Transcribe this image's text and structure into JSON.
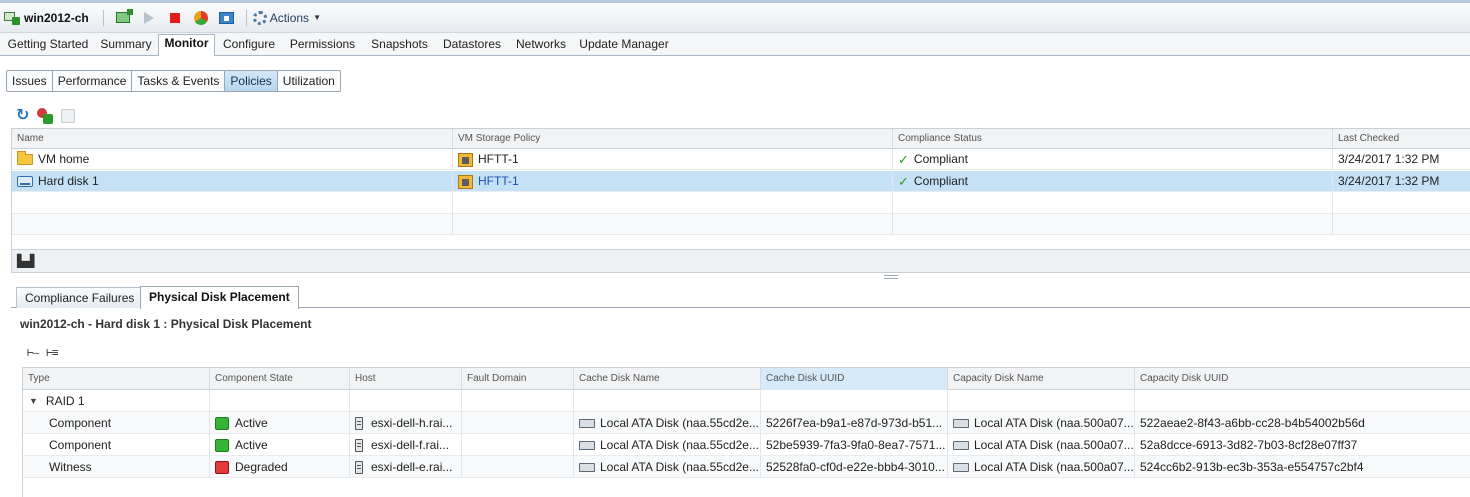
{
  "toolbar": {
    "vm_name": "win2012-ch",
    "actions_label": "Actions",
    "icons": [
      "vm-icon",
      "open-console-icon",
      "power-on-icon",
      "power-off-icon",
      "restart-guest-icon",
      "migrate-icon",
      "gear-icon"
    ]
  },
  "main_tabs": [
    "Getting Started",
    "Summary",
    "Monitor",
    "Configure",
    "Permissions",
    "Snapshots",
    "Datastores",
    "Networks",
    "Update Manager"
  ],
  "main_tab_active": "Monitor",
  "sub_tabs": [
    "Issues",
    "Performance",
    "Tasks & Events",
    "Policies",
    "Utilization"
  ],
  "sub_tab_active": "Policies",
  "policies_grid": {
    "columns": [
      "Name",
      "VM Storage Policy",
      "Compliance Status",
      "Last Checked"
    ],
    "rows": [
      {
        "name": "VM home",
        "icon": "folder-icon",
        "policy": "HFTT-1",
        "status": "Compliant",
        "last_checked": "3/24/2017 1:32 PM"
      },
      {
        "name": "Hard disk 1",
        "icon": "hard-disk-icon",
        "policy": "HFTT-1",
        "status": "Compliant",
        "last_checked": "3/24/2017 1:32 PM"
      }
    ]
  },
  "bottom_tabs": [
    "Compliance Failures",
    "Physical Disk Placement"
  ],
  "bottom_tab_active": "Physical Disk Placement",
  "placement_title": "win2012-ch - Hard disk 1 : Physical Disk Placement",
  "placement_grid": {
    "columns": [
      "Type",
      "Component State",
      "Host",
      "Fault Domain",
      "Cache Disk Name",
      "Cache Disk UUID",
      "Capacity Disk Name",
      "Capacity Disk UUID"
    ],
    "group_label": "RAID 1",
    "rows": [
      {
        "type": "Component",
        "state": "Active",
        "state_color": "#36b436",
        "host": "esxi-dell-h.rai...",
        "fault_domain": "",
        "cache_name": "Local ATA Disk (naa.55cd2e...",
        "cache_uuid": "5226f7ea-b9a1-e87d-973d-b51...",
        "capacity_name": "Local ATA Disk (naa.500a07...",
        "capacity_uuid": "522aeae2-8f43-a6bb-cc28-b4b54002b56d"
      },
      {
        "type": "Component",
        "state": "Active",
        "state_color": "#36b436",
        "host": "esxi-dell-f.rai...",
        "fault_domain": "",
        "cache_name": "Local ATA Disk (naa.55cd2e...",
        "cache_uuid": "52be5939-7fa3-9fa0-8ea7-7571...",
        "capacity_name": "Local ATA Disk (naa.500a07...",
        "capacity_uuid": "52a8dcce-6913-3d82-7b03-8cf28e07ff37"
      },
      {
        "type": "Witness",
        "state": "Degraded",
        "state_color": "#e03a3a",
        "host": "esxi-dell-e.rai...",
        "fault_domain": "",
        "cache_name": "Local ATA Disk (naa.55cd2e...",
        "cache_uuid": "52528fa0-cf0d-e22e-bbb4-3010...",
        "capacity_name": "Local ATA Disk (naa.500a07...",
        "capacity_uuid": "524cc6b2-913b-ec3b-353a-e554757c2bf4"
      }
    ]
  }
}
